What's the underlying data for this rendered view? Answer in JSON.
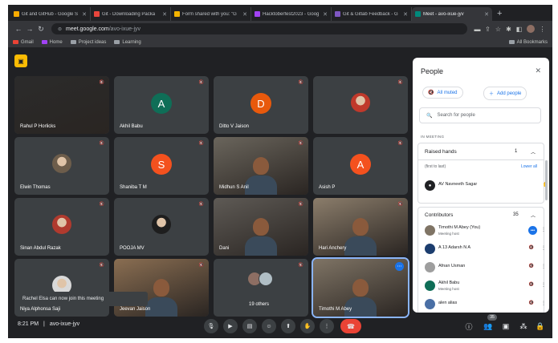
{
  "browser": {
    "tabs": [
      {
        "label": "Git and GitHub - Google S",
        "color": "#f9ab00",
        "active": false
      },
      {
        "label": "Git - Downloading Packa",
        "color": "#e8453c",
        "active": false
      },
      {
        "label": "Form shared with you: \"G",
        "color": "#f4b400",
        "active": false
      },
      {
        "label": "Hacktoberfest2023 - Goog",
        "color": "#a142f4",
        "active": false
      },
      {
        "label": "Git & Gitlab Feedback - G",
        "color": "#7e57c2",
        "active": false
      },
      {
        "label": "Meet - avo-ixue-jyv",
        "color": "#00897b",
        "active": true
      }
    ],
    "new_tab": "+",
    "url_host": "meet.google.com",
    "url_path": "/avo-ixue-jyv",
    "bookmarks": [
      "Gmail",
      "Home",
      "Project ideas",
      "Learning"
    ],
    "all_bookmarks": "All Bookmarks"
  },
  "tiles": [
    {
      "name": "Rahul P Horlicks",
      "kind": "video",
      "bg": "#2b2b2b"
    },
    {
      "name": "Akhil Babu",
      "kind": "avatar",
      "letter": "A",
      "color": "#0f6e57"
    },
    {
      "name": "Ditto V Jaison",
      "kind": "avatar",
      "letter": "D",
      "color": "#e8590c"
    },
    {
      "name": "",
      "kind": "photo",
      "color": "#c0392b"
    },
    {
      "name": "Elwin Thomas",
      "kind": "photo",
      "color": "#6d5d4b"
    },
    {
      "name": "Shaniba T M",
      "kind": "avatar",
      "letter": "S",
      "color": "#f4511e"
    },
    {
      "name": "Midhun S Anil",
      "kind": "video",
      "bg": "#6a655c"
    },
    {
      "name": "Asish P",
      "kind": "avatar",
      "letter": "A",
      "color": "#f4511e"
    },
    {
      "name": "Sinan Abdul Razak",
      "kind": "photo",
      "color": "#b03a2e"
    },
    {
      "name": "POOJA MV",
      "kind": "photo",
      "color": "#1e1e1e"
    },
    {
      "name": "Dani",
      "kind": "video",
      "bg": "#5e5a55"
    },
    {
      "name": "Hari Anchery",
      "kind": "video",
      "bg": "#8b7d6b"
    },
    {
      "name": "Niya Alphonsa Saji",
      "kind": "photo",
      "color": "#d9d9d9"
    },
    {
      "name": "Jeevan Jaison",
      "kind": "video",
      "bg": "#8a6e52"
    },
    {
      "name": "19 others",
      "kind": "others",
      "bg": "#3c4043"
    },
    {
      "name": "Timothi M Abey",
      "kind": "video",
      "bg": "#7f7465"
    }
  ],
  "toast": "Rachel Elsa can now join this meeting",
  "bottom": {
    "time": "8:21 PM",
    "separator": "|",
    "meeting_code": "avo-ixue-jyv",
    "participants_badge": "35"
  },
  "panel": {
    "title": "People",
    "all_muted": "All muted",
    "add_people": "Add people",
    "search_placeholder": "Search for people",
    "in_meeting": "IN MEETING",
    "raised_hands": {
      "label": "Raised hands",
      "count": "1",
      "hint": "(first to last)",
      "lower_all": "Lower all",
      "people": [
        {
          "name": "AV Navneeth Sagar"
        }
      ]
    },
    "contributors": {
      "label": "Contributors",
      "count": "35",
      "people": [
        {
          "name": "Timothi M Abey (You)",
          "sub": "Meeting host",
          "color": "#7f7465"
        },
        {
          "name": "A 13 Adarsh N A",
          "sub": "",
          "color": "#1c3d6e"
        },
        {
          "name": "Afnan Usman",
          "sub": "",
          "color": "#9e9e9e"
        },
        {
          "name": "Akhil Babu",
          "sub": "Meeting host",
          "color": "#0f6e57"
        },
        {
          "name": "alen alias",
          "sub": "",
          "color": "#4a6fa5"
        }
      ]
    }
  }
}
